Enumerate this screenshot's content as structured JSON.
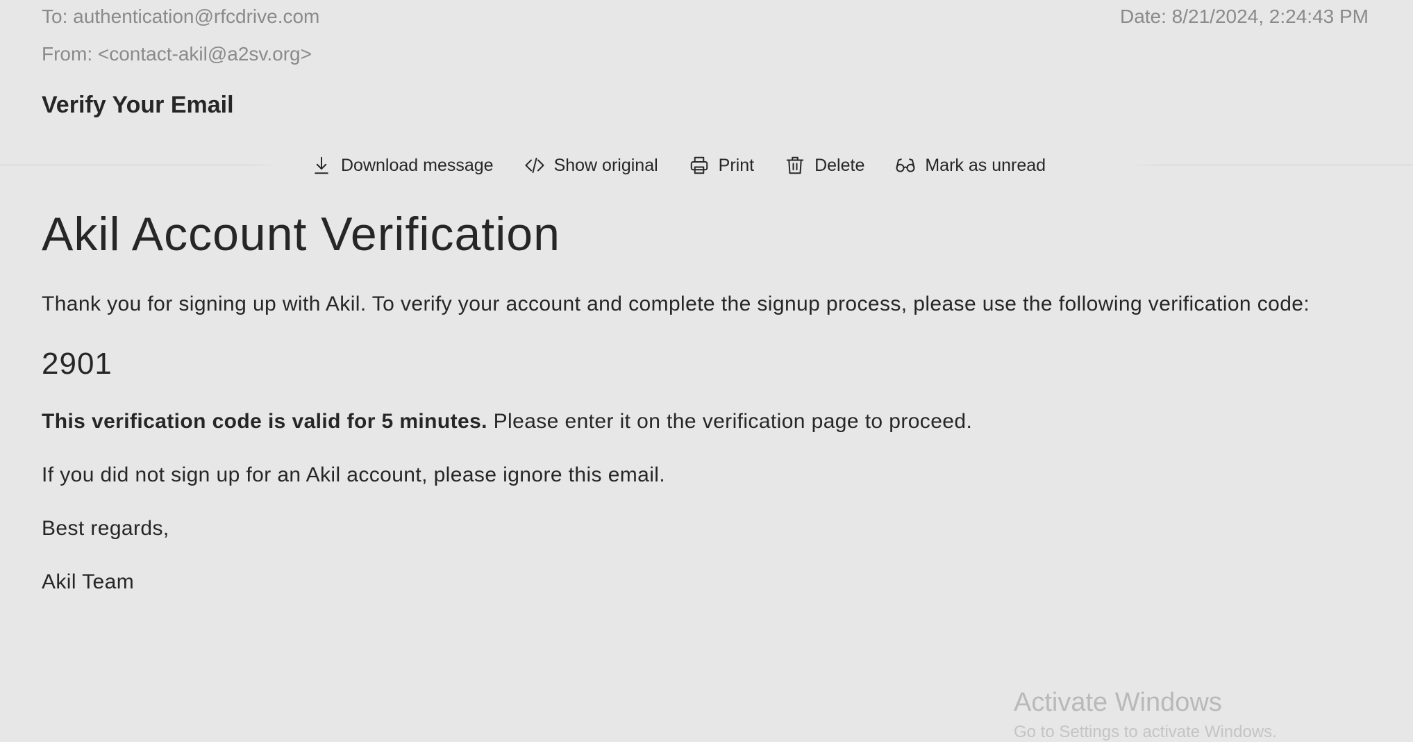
{
  "header": {
    "to": "To: authentication@rfcdrive.com",
    "from": "From: <contact-akil@a2sv.org>",
    "date": "Date: 8/21/2024, 2:24:43 PM",
    "subject": "Verify Your Email"
  },
  "toolbar": {
    "download_label": "Download message",
    "download_icon": "download-icon",
    "show_original_label": "Show original",
    "show_original_icon": "code-icon",
    "print_label": "Print",
    "print_icon": "printer-icon",
    "delete_label": "Delete",
    "delete_icon": "trash-icon",
    "mark_unread_label": "Mark as unread",
    "mark_unread_icon": "glasses-icon"
  },
  "message": {
    "heading": "Akil Account Verification",
    "intro": "Thank you for signing up with Akil. To verify your account and complete the signup process, please use the following verification code:",
    "code": "2901",
    "validity_bold": "This verification code is valid for 5 minutes.",
    "validity_rest": " Please enter it on the verification page to proceed.",
    "ignore": "If you did not sign up for an Akil account, please ignore this email.",
    "regards": "Best regards,",
    "signature": "Akil Team"
  },
  "watermark": {
    "title": "Activate Windows",
    "subtitle": "Go to Settings to activate Windows."
  },
  "colors": {
    "background": "#e7e7e7",
    "text": "#262626",
    "muted": "#8a8a8a"
  }
}
